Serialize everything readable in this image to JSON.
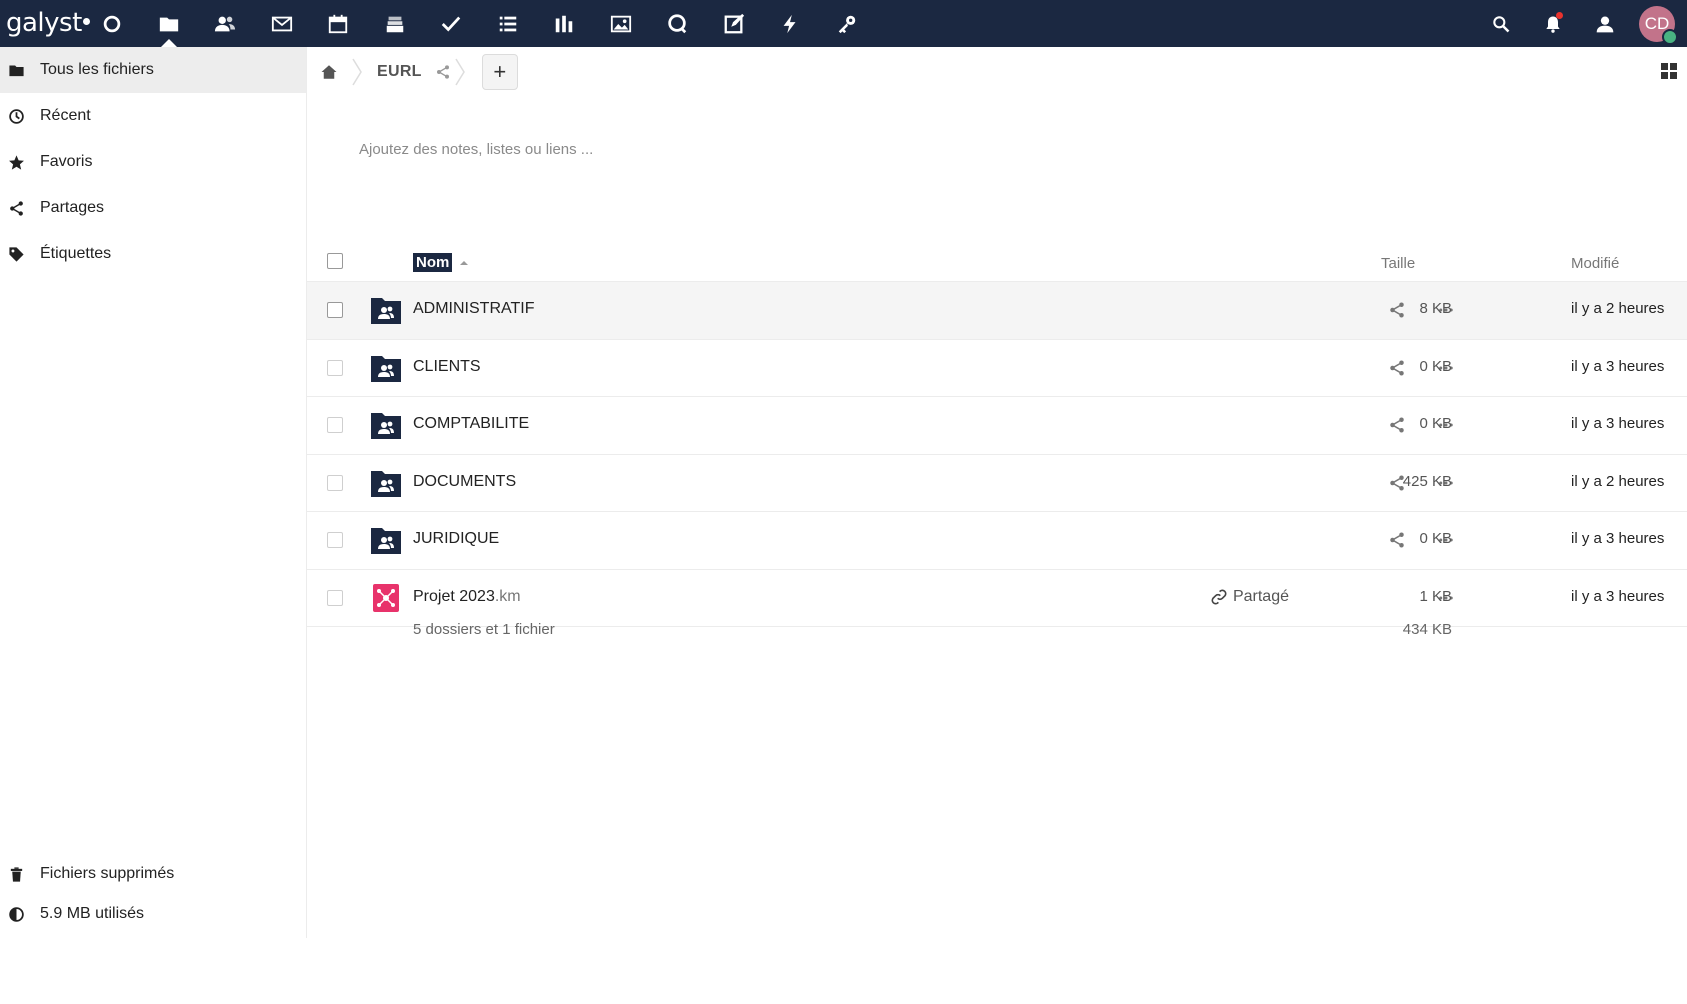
{
  "header": {
    "logo_text": "galyst",
    "apps": [
      {
        "name": "dashboard-icon"
      },
      {
        "name": "files-icon",
        "active": true
      },
      {
        "name": "contacts-icon"
      },
      {
        "name": "mail-icon"
      },
      {
        "name": "calendar-icon"
      },
      {
        "name": "deck-icon"
      },
      {
        "name": "tasks-icon"
      },
      {
        "name": "list-icon"
      },
      {
        "name": "analytics-icon"
      },
      {
        "name": "photos-icon"
      },
      {
        "name": "talk-icon"
      },
      {
        "name": "notes-icon"
      },
      {
        "name": "activity-icon"
      },
      {
        "name": "passwords-icon"
      }
    ],
    "avatar_initials": "CD"
  },
  "sidebar": {
    "items": [
      {
        "label": "Tous les fichiers",
        "icon": "folder-icon",
        "active": true
      },
      {
        "label": "Récent",
        "icon": "clock-icon"
      },
      {
        "label": "Favoris",
        "icon": "star-icon"
      },
      {
        "label": "Partages",
        "icon": "share-icon"
      },
      {
        "label": "Étiquettes",
        "icon": "tag-icon"
      }
    ],
    "trash_label": "Fichiers supprimés",
    "quota_label": "5.9 MB utilisés"
  },
  "breadcrumb": {
    "folder": "EURL",
    "new_button": "+"
  },
  "notes_placeholder": "Ajoutez des notes, listes ou liens ...",
  "table": {
    "col_name": "Nom",
    "col_size": "Taille",
    "col_modified": "Modifié",
    "rows": [
      {
        "name": "ADMINISTRATIF",
        "ext": "",
        "type": "group-folder",
        "size": "8 KB",
        "modified": "il y a 2 heures"
      },
      {
        "name": "CLIENTS",
        "ext": "",
        "type": "group-folder",
        "size": "0 KB",
        "modified": "il y a 3 heures"
      },
      {
        "name": "COMPTABILITE",
        "ext": "",
        "type": "group-folder",
        "size": "0 KB",
        "modified": "il y a 3 heures"
      },
      {
        "name": "DOCUMENTS",
        "ext": "",
        "type": "group-folder",
        "size": "425 KB",
        "modified": "il y a 2 heures"
      },
      {
        "name": "JURIDIQUE",
        "ext": "",
        "type": "group-folder",
        "size": "0 KB",
        "modified": "il y a 3 heures"
      },
      {
        "name": "Projet 2023",
        "ext": ".km",
        "type": "mindmap-file",
        "shared_label": "Partagé",
        "size": "1 KB",
        "modified": "il y a 3 heures"
      }
    ],
    "summary_count": "5 dossiers et 1 fichier",
    "summary_total": "434 KB"
  },
  "colors": {
    "header_bg": "#1b2841",
    "accent_red": "#e9322d",
    "mindmap_pink": "#e8336b",
    "avatar_bg": "#c2738a"
  }
}
